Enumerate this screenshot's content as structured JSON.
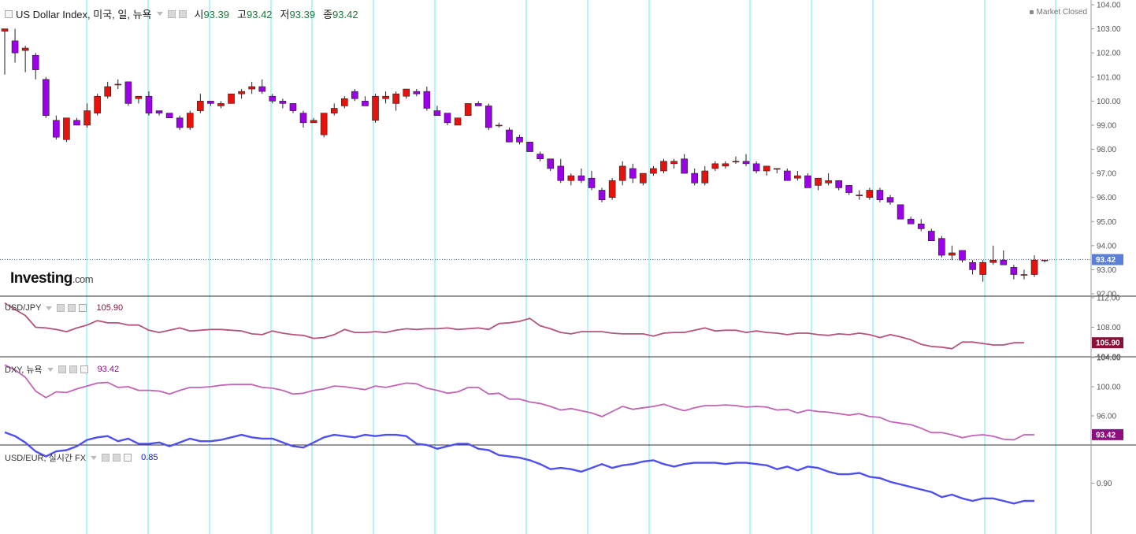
{
  "main_legend": {
    "title": "US Dollar Index, 미국, 일, 뉴욕",
    "open_label": "시",
    "open": "93.39",
    "high_label": "고",
    "high": "93.42",
    "low_label": "저",
    "low": "93.39",
    "close_label": "종",
    "close": "93.42"
  },
  "status": "Market Closed",
  "logo": {
    "name": "Investing",
    "suffix": ".com"
  },
  "colors": {
    "up": "#e8120c",
    "down": "#9b00e8",
    "usdjpy": "#b4547e",
    "dxy": "#c064b4",
    "usdeur": "#5050ee",
    "vline": "#6ee8f0",
    "price_line": "#3a6ea8"
  },
  "panes": [
    {
      "label": "USD/JPY",
      "value": "105.90",
      "color": "#b4547e",
      "badge_color": "#8a1038",
      "has_close": true
    },
    {
      "label": "DXY, 뉴욕",
      "value": "93.42",
      "color": "#c064b4",
      "badge_color": "#8a1080",
      "has_close": false
    },
    {
      "label": "USD/EUR, 실시간 FX",
      "value": "0.85",
      "color": "#5050ee",
      "badge_color": "#1010dd",
      "has_close": true
    }
  ],
  "chart_data": [
    {
      "type": "candlestick",
      "title": "US Dollar Index, 미국, 일, 뉴욕",
      "ylim": [
        92.0,
        104.0
      ],
      "y_ticks": [
        "104.00",
        "103.00",
        "102.00",
        "101.00",
        "100.00",
        "99.00",
        "98.00",
        "97.00",
        "96.00",
        "95.00",
        "94.00",
        "93.00",
        "92.00"
      ],
      "last_value": "93.42",
      "ohlc": [
        [
          102.9,
          103.0,
          101.1,
          103.0
        ],
        [
          102.5,
          103.0,
          101.6,
          102.0
        ],
        [
          102.1,
          102.3,
          101.2,
          102.2
        ],
        [
          101.9,
          102.0,
          100.9,
          101.3
        ],
        [
          100.9,
          101.0,
          99.3,
          99.4
        ],
        [
          99.2,
          99.4,
          98.4,
          98.5
        ],
        [
          98.4,
          99.3,
          98.3,
          99.3
        ],
        [
          99.2,
          99.3,
          99.0,
          99.0
        ],
        [
          99.0,
          99.9,
          98.9,
          99.6
        ],
        [
          99.5,
          100.3,
          99.4,
          100.2
        ],
        [
          100.2,
          100.8,
          100.1,
          100.6
        ],
        [
          100.7,
          100.9,
          100.5,
          100.7
        ],
        [
          100.8,
          100.8,
          99.8,
          99.9
        ],
        [
          100.1,
          100.2,
          99.9,
          100.2
        ],
        [
          100.2,
          100.4,
          99.4,
          99.5
        ],
        [
          99.6,
          99.6,
          99.4,
          99.5
        ],
        [
          99.5,
          99.5,
          99.3,
          99.3
        ],
        [
          99.3,
          99.4,
          98.8,
          98.9
        ],
        [
          98.9,
          99.6,
          98.8,
          99.5
        ],
        [
          99.6,
          100.3,
          99.5,
          100.0
        ],
        [
          100.0,
          100.0,
          99.8,
          99.9
        ],
        [
          99.8,
          100.0,
          99.7,
          99.9
        ],
        [
          99.9,
          100.3,
          99.9,
          100.3
        ],
        [
          100.3,
          100.5,
          100.1,
          100.4
        ],
        [
          100.5,
          100.8,
          100.3,
          100.6
        ],
        [
          100.6,
          100.9,
          100.3,
          100.4
        ],
        [
          100.2,
          100.3,
          99.9,
          100.0
        ],
        [
          100.0,
          100.1,
          99.7,
          99.9
        ],
        [
          99.9,
          99.9,
          99.5,
          99.6
        ],
        [
          99.5,
          99.6,
          98.9,
          99.1
        ],
        [
          99.1,
          99.3,
          99.1,
          99.2
        ],
        [
          98.6,
          99.5,
          98.5,
          99.5
        ],
        [
          99.5,
          99.9,
          99.4,
          99.7
        ],
        [
          99.8,
          100.2,
          99.7,
          100.1
        ],
        [
          100.4,
          100.5,
          100.0,
          100.1
        ],
        [
          100.0,
          100.2,
          99.8,
          99.8
        ],
        [
          99.2,
          100.3,
          99.1,
          100.2
        ],
        [
          100.1,
          100.4,
          99.9,
          100.2
        ],
        [
          99.9,
          100.4,
          99.6,
          100.3
        ],
        [
          100.2,
          100.5,
          100.1,
          100.5
        ],
        [
          100.4,
          100.5,
          100.2,
          100.3
        ],
        [
          100.4,
          100.6,
          99.6,
          99.7
        ],
        [
          99.6,
          99.8,
          99.4,
          99.4
        ],
        [
          99.5,
          99.5,
          99.0,
          99.1
        ],
        [
          99.0,
          99.3,
          99.0,
          99.3
        ],
        [
          99.4,
          99.9,
          99.4,
          99.9
        ],
        [
          99.9,
          100.0,
          99.8,
          99.8
        ],
        [
          99.8,
          99.9,
          98.8,
          98.9
        ],
        [
          99.0,
          99.1,
          98.9,
          99.0
        ],
        [
          98.8,
          98.9,
          98.3,
          98.3
        ],
        [
          98.5,
          98.6,
          98.2,
          98.3
        ],
        [
          98.3,
          98.3,
          97.9,
          97.9
        ],
        [
          97.8,
          97.9,
          97.5,
          97.6
        ],
        [
          97.6,
          97.6,
          97.1,
          97.2
        ],
        [
          97.3,
          97.6,
          96.6,
          96.7
        ],
        [
          96.7,
          97.0,
          96.5,
          96.9
        ],
        [
          96.9,
          97.2,
          96.6,
          96.7
        ],
        [
          96.8,
          97.1,
          96.3,
          96.4
        ],
        [
          96.3,
          96.4,
          95.8,
          95.9
        ],
        [
          96.0,
          96.8,
          95.9,
          96.7
        ],
        [
          96.7,
          97.5,
          96.5,
          97.3
        ],
        [
          97.2,
          97.4,
          96.6,
          96.8
        ],
        [
          96.6,
          97.0,
          96.5,
          97.0
        ],
        [
          97.0,
          97.3,
          96.9,
          97.2
        ],
        [
          97.1,
          97.6,
          97.0,
          97.5
        ],
        [
          97.4,
          97.6,
          97.2,
          97.5
        ],
        [
          97.6,
          97.8,
          97.0,
          97.0
        ],
        [
          97.0,
          97.2,
          96.5,
          96.6
        ],
        [
          96.6,
          97.3,
          96.5,
          97.1
        ],
        [
          97.2,
          97.5,
          97.1,
          97.4
        ],
        [
          97.3,
          97.5,
          97.2,
          97.4
        ],
        [
          97.5,
          97.7,
          97.4,
          97.5
        ],
        [
          97.5,
          97.8,
          97.3,
          97.4
        ],
        [
          97.4,
          97.5,
          97.0,
          97.1
        ],
        [
          97.1,
          97.3,
          96.9,
          97.3
        ],
        [
          97.2,
          97.2,
          97.0,
          97.2
        ],
        [
          97.1,
          97.2,
          96.7,
          96.7
        ],
        [
          96.8,
          97.1,
          96.7,
          96.9
        ],
        [
          96.9,
          97.0,
          96.4,
          96.4
        ],
        [
          96.5,
          96.7,
          96.3,
          96.8
        ],
        [
          96.6,
          97.0,
          96.5,
          96.7
        ],
        [
          96.7,
          96.7,
          96.3,
          96.4
        ],
        [
          96.5,
          96.5,
          96.1,
          96.2
        ],
        [
          96.1,
          96.3,
          95.9,
          96.1
        ],
        [
          96.0,
          96.4,
          95.9,
          96.3
        ],
        [
          96.3,
          96.4,
          95.8,
          95.9
        ],
        [
          96.0,
          96.1,
          95.7,
          95.8
        ],
        [
          95.7,
          95.7,
          95.1,
          95.1
        ],
        [
          95.1,
          95.2,
          94.9,
          94.9
        ],
        [
          94.9,
          95.1,
          94.6,
          94.7
        ],
        [
          94.6,
          94.7,
          94.3,
          94.2
        ],
        [
          94.3,
          94.4,
          93.5,
          93.6
        ],
        [
          93.6,
          94.0,
          93.4,
          93.7
        ],
        [
          93.8,
          93.8,
          93.3,
          93.4
        ],
        [
          93.3,
          93.4,
          92.8,
          93.0
        ],
        [
          92.8,
          93.4,
          92.5,
          93.3
        ],
        [
          93.3,
          94.0,
          93.2,
          93.4
        ],
        [
          93.4,
          93.8,
          93.2,
          93.2
        ],
        [
          93.1,
          93.2,
          92.6,
          92.8
        ],
        [
          92.8,
          93.0,
          92.6,
          92.8
        ],
        [
          92.8,
          93.6,
          92.7,
          93.4
        ],
        [
          93.4,
          93.4,
          93.3,
          93.4
        ]
      ]
    },
    {
      "type": "line",
      "name": "USD/JPY",
      "ylim": [
        104.0,
        112.0
      ],
      "y_ticks": [
        "112.00",
        "108.00",
        "104.00"
      ],
      "last_value": "105.90",
      "values": [
        111.3,
        110.4,
        109.6,
        108.0,
        107.9,
        107.7,
        107.4,
        107.9,
        108.3,
        108.9,
        108.6,
        108.6,
        108.3,
        108.3,
        107.6,
        107.3,
        107.6,
        107.9,
        107.5,
        107.6,
        107.7,
        107.7,
        107.6,
        107.5,
        107.1,
        107.0,
        107.5,
        107.2,
        107.0,
        106.9,
        106.5,
        106.6,
        107.0,
        107.7,
        107.3,
        107.3,
        107.4,
        107.3,
        107.6,
        107.8,
        107.7,
        107.8,
        107.8,
        107.9,
        107.7,
        107.8,
        107.9,
        107.7,
        108.5,
        108.6,
        108.8,
        109.2,
        108.2,
        107.8,
        107.3,
        107.1,
        107.4,
        107.4,
        107.4,
        107.2,
        107.1,
        107.1,
        107.1,
        106.8,
        107.2,
        107.3,
        107.3,
        107.6,
        107.9,
        107.5,
        107.6,
        107.6,
        107.3,
        107.5,
        107.3,
        107.2,
        107.0,
        107.2,
        107.2,
        107.0,
        106.9,
        107.1,
        107.0,
        107.2,
        107.0,
        106.6,
        107.0,
        106.7,
        106.3,
        105.7,
        105.4,
        105.3,
        105.1,
        106.0,
        106.0,
        105.8,
        105.6,
        105.6,
        105.9,
        105.9
      ]
    },
    {
      "type": "line",
      "name": "DXY",
      "ylim": [
        92.0,
        104.0
      ],
      "y_ticks": [
        "104.00",
        "100.00",
        "96.00"
      ],
      "last_value": "93.42",
      "values": [
        103.0,
        102.3,
        101.3,
        99.4,
        98.5,
        99.3,
        99.2,
        99.7,
        100.1,
        100.5,
        100.6,
        99.9,
        100.0,
        99.5,
        99.5,
        99.4,
        99.0,
        99.5,
        99.9,
        99.9,
        100.0,
        100.2,
        100.3,
        100.3,
        100.3,
        99.9,
        99.8,
        99.5,
        99.0,
        99.1,
        99.5,
        99.7,
        100.1,
        100.0,
        99.8,
        99.6,
        100.1,
        99.9,
        100.2,
        100.5,
        100.4,
        99.8,
        99.5,
        99.1,
        99.3,
        99.9,
        99.9,
        99.0,
        99.1,
        98.3,
        98.3,
        97.9,
        97.7,
        97.3,
        96.8,
        97.0,
        96.7,
        96.4,
        95.9,
        96.6,
        97.3,
        96.9,
        97.1,
        97.3,
        97.6,
        97.1,
        96.7,
        97.1,
        97.4,
        97.4,
        97.5,
        97.4,
        97.2,
        97.3,
        97.2,
        96.8,
        96.9,
        96.4,
        96.8,
        96.6,
        96.5,
        96.3,
        96.1,
        96.3,
        95.9,
        95.8,
        95.2,
        95.0,
        94.8,
        94.3,
        93.7,
        93.7,
        93.4,
        93.0,
        93.3,
        93.4,
        93.2,
        92.8,
        92.7,
        93.4,
        93.4
      ]
    },
    {
      "type": "line",
      "name": "USD/EUR",
      "ylim": [
        0.86,
        0.93
      ],
      "y_ticks": [
        "0.90"
      ],
      "last_value": "0.85",
      "values": [
        0.94,
        0.937,
        0.932,
        0.925,
        0.921,
        0.925,
        0.926,
        0.929,
        0.934,
        0.936,
        0.937,
        0.933,
        0.935,
        0.931,
        0.931,
        0.932,
        0.929,
        0.932,
        0.935,
        0.933,
        0.933,
        0.934,
        0.936,
        0.938,
        0.936,
        0.935,
        0.935,
        0.932,
        0.929,
        0.928,
        0.932,
        0.936,
        0.938,
        0.937,
        0.936,
        0.938,
        0.937,
        0.938,
        0.938,
        0.937,
        0.931,
        0.93,
        0.927,
        0.929,
        0.931,
        0.931,
        0.927,
        0.926,
        0.922,
        0.921,
        0.92,
        0.918,
        0.915,
        0.911,
        0.912,
        0.911,
        0.909,
        0.912,
        0.915,
        0.912,
        0.914,
        0.915,
        0.917,
        0.918,
        0.915,
        0.913,
        0.915,
        0.916,
        0.916,
        0.916,
        0.915,
        0.916,
        0.916,
        0.915,
        0.914,
        0.911,
        0.913,
        0.91,
        0.913,
        0.912,
        0.909,
        0.907,
        0.907,
        0.908,
        0.905,
        0.904,
        0.901,
        0.899,
        0.897,
        0.895,
        0.893,
        0.889,
        0.891,
        0.888,
        0.886,
        0.888,
        0.888,
        0.886,
        0.884,
        0.886,
        0.886
      ]
    }
  ]
}
